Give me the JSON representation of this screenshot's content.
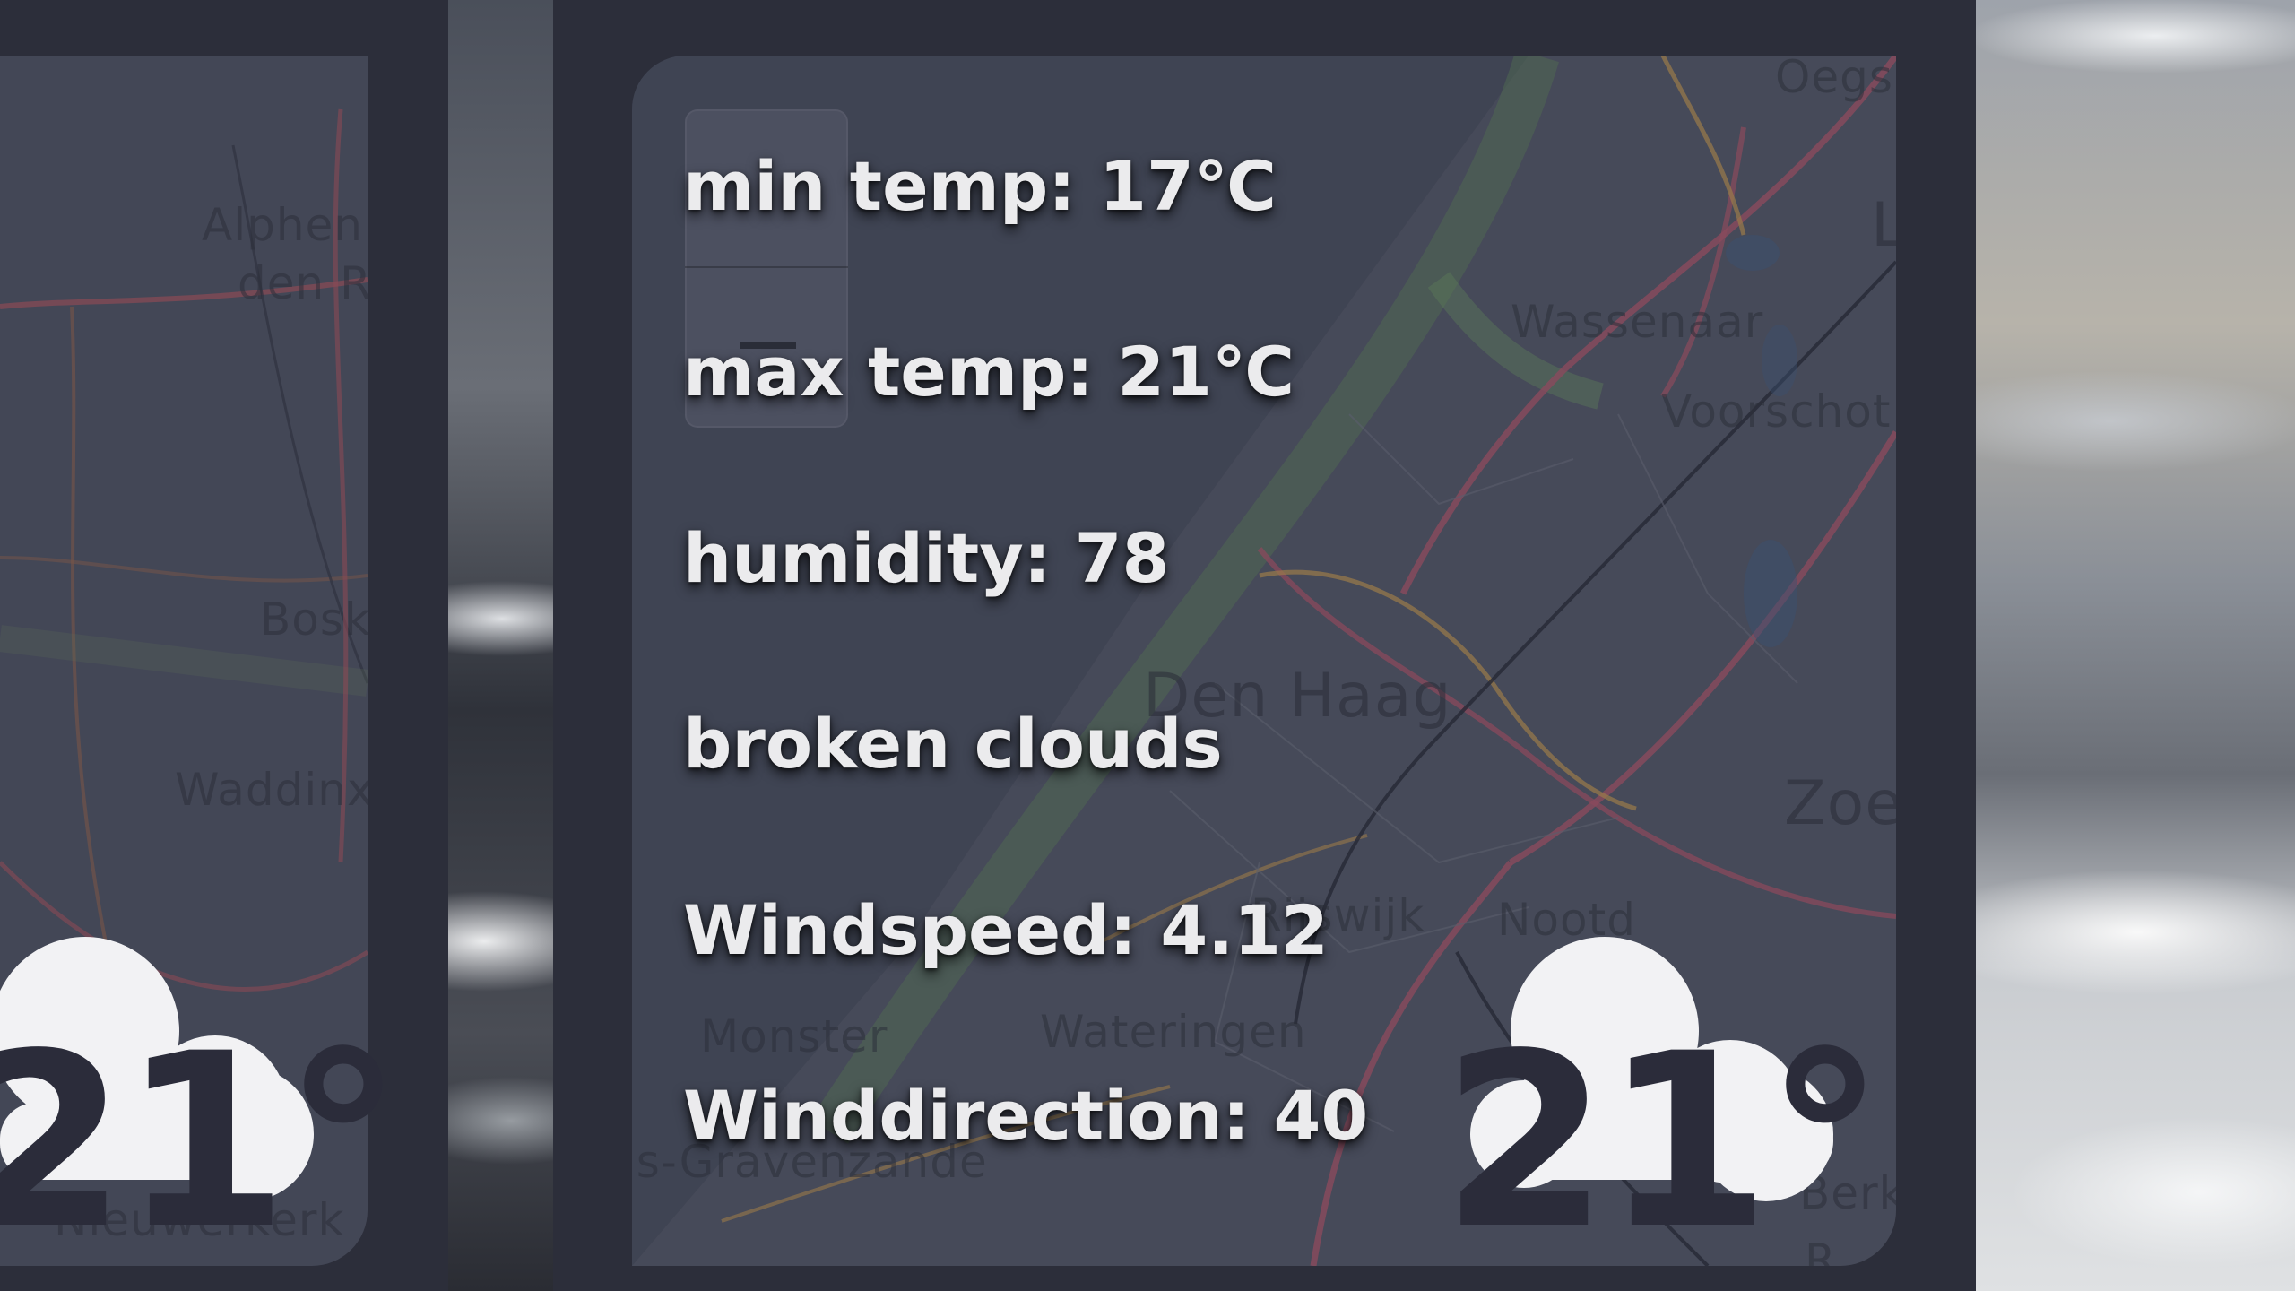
{
  "weather": {
    "min_temp": "min temp: 17℃",
    "max_temp": "max temp: 21℃",
    "humidity": "humidity: 78",
    "description": "broken clouds",
    "windspeed": "Windspeed: 4.12",
    "winddirection": "Winddirection: 40",
    "temperature": "21°",
    "icon": "cloud-icon"
  },
  "left_card": {
    "temperature": "21°",
    "icon": "cloud-icon"
  },
  "map": {
    "left_places": [
      "Alphen",
      "den R",
      "Bosk",
      "Waddinx",
      "Nieuwerkerk"
    ],
    "main_places": [
      "Oegs",
      "L",
      "Wassenaar",
      "Voorschot",
      "Den Haag",
      "Zoe",
      "Rijswijk",
      "Nootd",
      "Monster",
      "Wateringen",
      "'s-Gravenzande",
      "Berk",
      "R"
    ]
  },
  "colors": {
    "frame": "#2c2e3a",
    "map_panel": "#434756",
    "text": "#ebebed",
    "badge_cloud": "#f2f2f4",
    "badge_text": "#2b2c3a"
  }
}
